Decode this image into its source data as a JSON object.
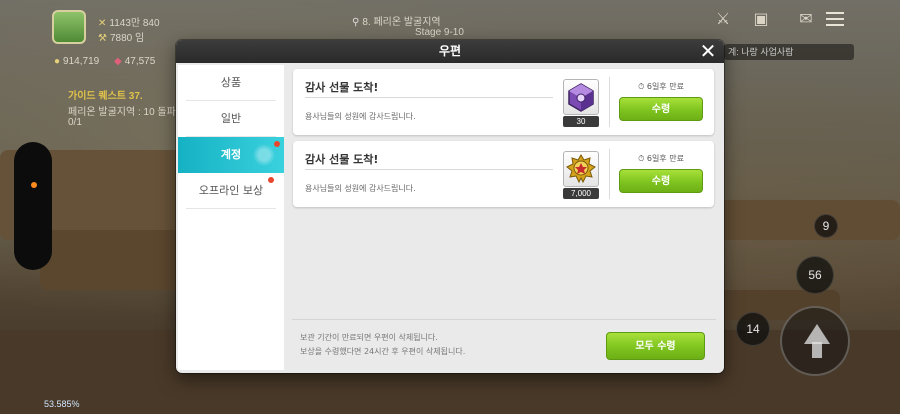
{
  "hud": {
    "power_icon": "crossed-swords-icon",
    "power_value": "1143만 840",
    "attack_icon": "hammer-icon",
    "attack_value": "7880 임",
    "gold_value": "914,719",
    "gem_value": "47,575",
    "quest_title": "가이드 퀘스트 37.",
    "quest_desc": "페리온 발굴지역 : 10 돌파",
    "quest_progress": "0/1",
    "location": "8. 페리온 발굴지역",
    "stage": "Stage 9-10",
    "chat_preview": "계: 나랑 사업사람",
    "counters": [
      "9",
      "56",
      "14"
    ],
    "level_text": "53.585%"
  },
  "mailbox": {
    "title": "우편",
    "close_icon": "close-icon",
    "tabs": [
      {
        "label": "상품",
        "active": false,
        "dot": false
      },
      {
        "label": "일반",
        "active": false,
        "dot": false
      },
      {
        "label": "계정",
        "active": true,
        "dot": true
      },
      {
        "label": "오프라인 보상",
        "active": false,
        "dot": true
      }
    ],
    "mails": [
      {
        "title": "감사 선물 도착!",
        "desc": "용사님들의 성원에 감사드립니다.",
        "item_icon": "purple-cube-icon",
        "item_count": "30",
        "expiry": "6일후 만료",
        "receive_label": "수령"
      },
      {
        "title": "감사 선물 도착!",
        "desc": "용사님들의 성원에 감사드립니다.",
        "item_icon": "gold-medal-icon",
        "item_count": "7,000",
        "expiry": "6일후 만료",
        "receive_label": "수령"
      }
    ],
    "footer_note_1": "보관 기간이 만료되면 우편이 삭제됩니다.",
    "footer_note_2": "보상을 수령했다면 24시간 후 우편이 삭제됩니다.",
    "receive_all_label": "모두 수령"
  }
}
